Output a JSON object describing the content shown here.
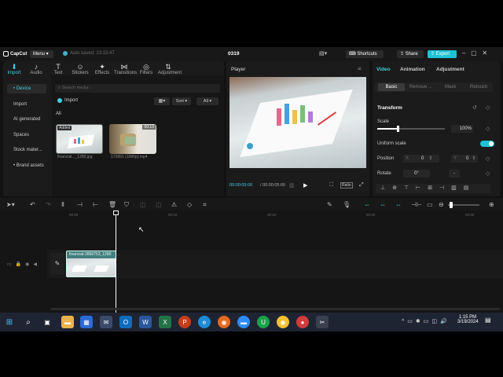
{
  "app": {
    "name": "CapCut",
    "menu": "Menu",
    "autosave": "Auto saved: 13:15:47",
    "project": "0319",
    "shortcuts": "Shortcuts",
    "share": "Share",
    "export": "Export"
  },
  "toolbar": [
    {
      "label": "Import",
      "icon": "import-icon"
    },
    {
      "label": "Audio",
      "icon": "audio-icon"
    },
    {
      "label": "Text",
      "icon": "text-icon"
    },
    {
      "label": "Stickers",
      "icon": "stickers-icon"
    },
    {
      "label": "Effects",
      "icon": "effects-icon"
    },
    {
      "label": "Transitions",
      "icon": "transitions-icon"
    },
    {
      "label": "Filters",
      "icon": "filters-icon"
    },
    {
      "label": "Adjustment",
      "icon": "adjustment-icon"
    }
  ],
  "sidebar": [
    "• Device",
    "Import",
    "AI generated",
    "Spaces",
    "Stock mater...",
    "• Brand assets"
  ],
  "media": {
    "search_placeholder": "Search media",
    "import": "Import",
    "sort": "Sort",
    "all_filter": "All",
    "all_label": "All",
    "items": [
      {
        "badge": "Added",
        "caption": "financial..._1280.jpg"
      },
      {
        "badge": "00:13",
        "caption": "172891 (1080p).mp4"
      }
    ]
  },
  "player": {
    "title": "Player",
    "time_current": "00:00:05:00",
    "time_total": "00:00:05:00",
    "ratio": "Ratio"
  },
  "inspector": {
    "tabs": [
      "Video",
      "Animation",
      "Adjustment"
    ],
    "subtabs": [
      "Basic",
      "Remove ...",
      "Mask",
      "Retouch"
    ],
    "transform": "Transform",
    "scale_label": "Scale",
    "scale_value": "100%",
    "scale_level": 0.3,
    "uniform_scale": "Uniform scale",
    "position_label": "Position",
    "pos_x_label": "X",
    "pos_x": "0",
    "pos_y_label": "Y",
    "pos_y": "0",
    "rotate_label": "Rotate",
    "rotate_value": "0°",
    "rotate_btn": "-"
  },
  "timeline": {
    "ticks": [
      "00:00",
      "00:10",
      "00:20",
      "00:30",
      "00:40"
    ],
    "clip_label": "financial-2860753_1280"
  },
  "taskbar": {
    "time": "1:15 PM",
    "date": "3/19/2024"
  }
}
